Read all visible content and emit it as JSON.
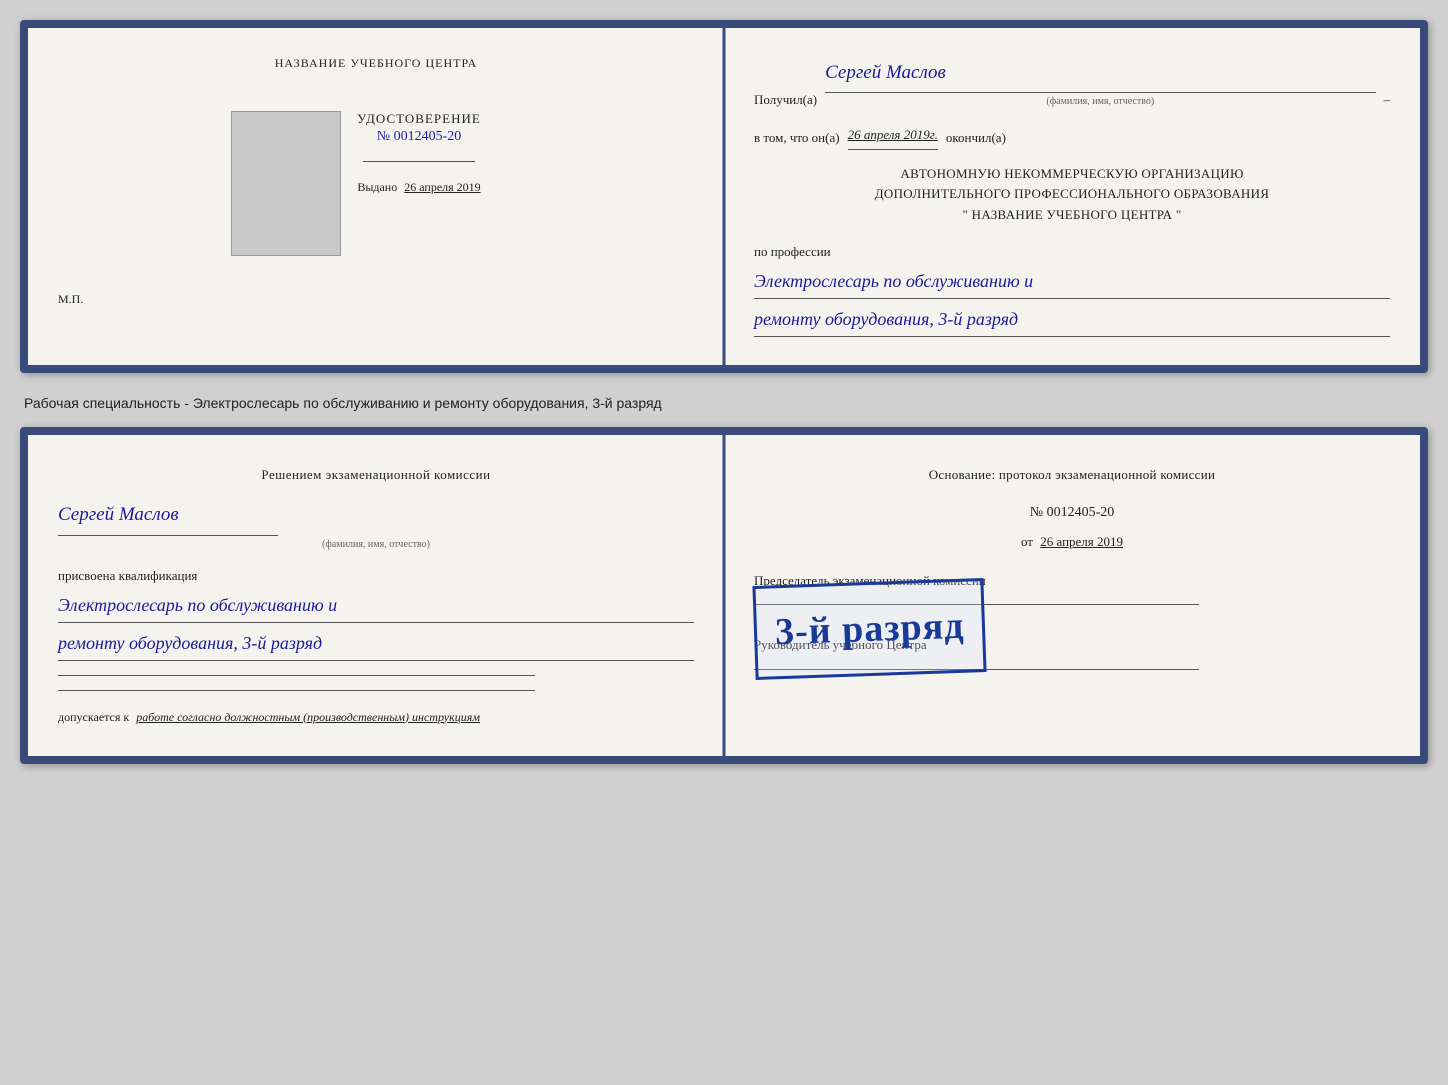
{
  "top_book": {
    "left": {
      "school_name": "НАЗВАНИЕ УЧЕБНОГО ЦЕНТРА",
      "udostoverenie_label": "УДОСТОВЕРЕНИЕ",
      "cert_number": "№ 0012405-20",
      "vydano_label": "Выдано",
      "vydano_date": "26 апреля 2019",
      "mp_label": "М.П."
    },
    "right": {
      "poluchil_label": "Получил(а)",
      "poluchil_name": "Сергей Маслов",
      "fio_sub": "(фамилия, имя, отчество)",
      "dash": "–",
      "vtom_label": "в том, что он(а)",
      "vtom_date": "26 апреля 2019г.",
      "okonchil_label": "окончил(а)",
      "org_line1": "АВТОНОМНУЮ НЕКОММЕРЧЕСКУЮ ОРГАНИЗАЦИЮ",
      "org_line2": "ДОПОЛНИТЕЛЬНОГО ПРОФЕССИОНАЛЬНОГО ОБРАЗОВАНИЯ",
      "org_name": "\"   НАЗВАНИЕ УЧЕБНОГО ЦЕНТРА   \"",
      "po_professii_label": "по профессии",
      "profession": "Электрослесарь по обслуживанию и",
      "profession2": "ремонту оборудования, 3-й разряд"
    }
  },
  "caption": "Рабочая специальность - Электрослесарь по обслуживанию и ремонту оборудования, 3-й разряд",
  "bottom_book": {
    "left": {
      "resheniem_label": "Решением экзаменационной комиссии",
      "person_name": "Сергей Маслов",
      "fio_sub": "(фамилия, имя, отчество)",
      "prisvoena_label": "присвоена квалификация",
      "qualification1": "Электрослесарь по обслуживанию и",
      "qualification2": "ремонту оборудования, 3-й разряд",
      "dopuskaetsya_label": "допускается к",
      "dopusk_value": "работе согласно должностным (производственным) инструкциям"
    },
    "right": {
      "osnovanie_label": "Основание: протокол экзаменационной комиссии",
      "num_label": "№ 0012405-20",
      "ot_label": "от",
      "ot_date": "26 апреля 2019",
      "predsedatel_label": "Председатель экзаменационной комиссии",
      "rukovoditel_label": "Руководитель учебного Центра"
    },
    "stamp": {
      "text": "3-й разряд"
    }
  }
}
